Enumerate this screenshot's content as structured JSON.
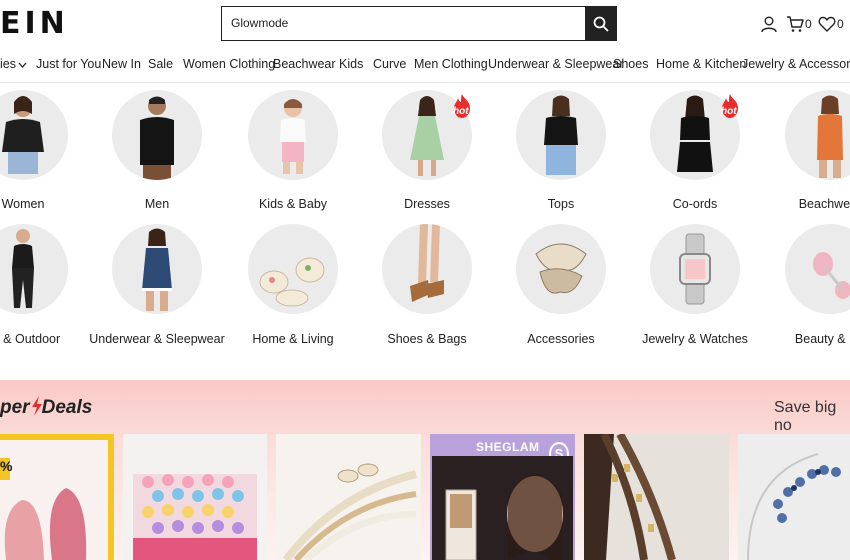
{
  "header": {
    "logo": "EIN",
    "search_value": "Glowmode",
    "cart_count": "0",
    "wishlist_count": "0"
  },
  "nav": {
    "items": [
      "ies",
      "Just for You",
      "New In",
      "Sale",
      "Women Clothing",
      "Beachwear",
      "Kids",
      "Curve",
      "Men Clothing",
      "Underwear & Sleepwear",
      "Shoes",
      "Home & Kitchen",
      "Jewelry & Accessories"
    ]
  },
  "categories": {
    "row1": [
      "Women",
      "Men",
      "Kids & Baby",
      "Dresses",
      "Tops",
      "Co-ords",
      "Beachwear"
    ],
    "row2": [
      "rts & Outdoor",
      "Underwear & Sleepwear",
      "Home & Living",
      "Shoes & Bags",
      "Accessories",
      "Jewelry & Watches",
      "Beauty & He"
    ],
    "hot_badge": "hot"
  },
  "deals": {
    "title_prefix": "per",
    "title_suffix": "eals",
    "save_text": "Save big no",
    "discount_fragment": "%",
    "sheglam_label": "SHEGLAM"
  },
  "colors": {
    "accent": "#e52e2e",
    "deals_band": "#f9c9c6",
    "yellow_frame": "#f3c623"
  },
  "icons": [
    "search-icon",
    "user-icon",
    "cart-icon",
    "heart-icon",
    "chevron-down-icon",
    "hot-flame-icon",
    "lightning-icon"
  ]
}
